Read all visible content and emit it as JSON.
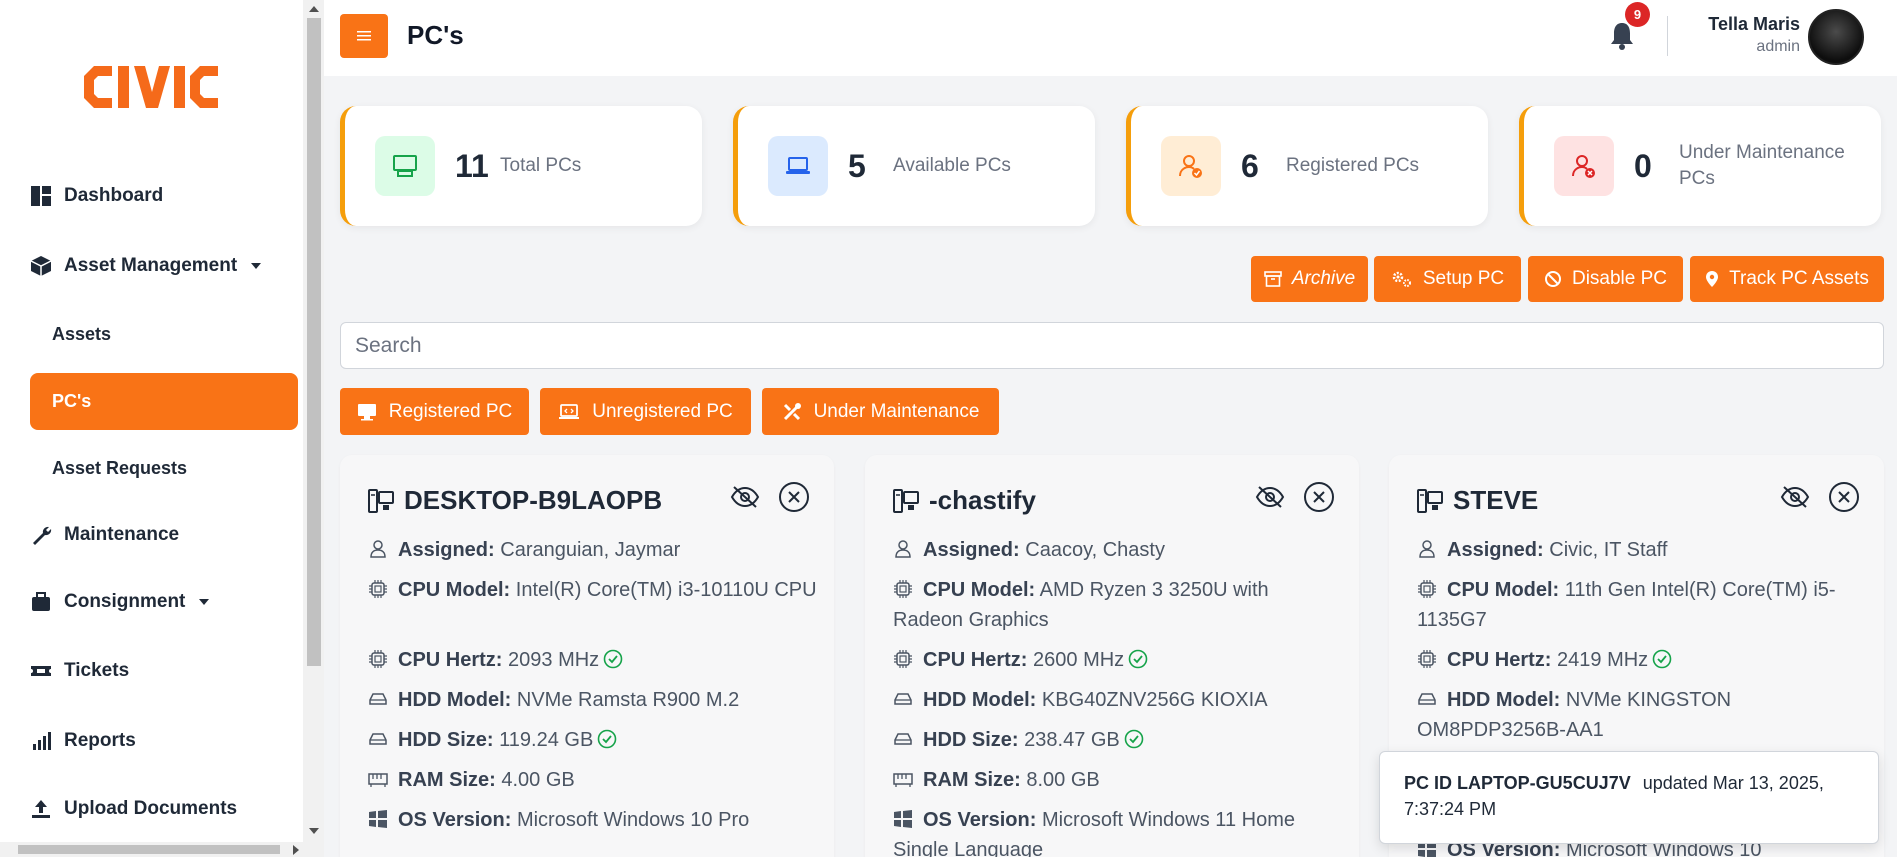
{
  "app": {
    "logo_text": "CIVIC"
  },
  "sidebar": {
    "items": [
      {
        "label": "Dashboard"
      },
      {
        "label": "Asset Management"
      },
      {
        "label": "Assets"
      },
      {
        "label": "PC's"
      },
      {
        "label": "Asset Requests"
      },
      {
        "label": "Maintenance"
      },
      {
        "label": "Consignment"
      },
      {
        "label": "Tickets"
      },
      {
        "label": "Reports"
      },
      {
        "label": "Upload Documents"
      }
    ]
  },
  "header": {
    "title": "PC's",
    "notification_count": "9",
    "user_name": "Tella Maris",
    "user_role": "admin"
  },
  "stats": [
    {
      "value": "11",
      "label": "Total PCs"
    },
    {
      "value": "5",
      "label": "Available PCs"
    },
    {
      "value": "6",
      "label": "Registered PCs"
    },
    {
      "value": "0",
      "label": "Under Maintenance PCs"
    }
  ],
  "actions": {
    "archive": "Archive",
    "setup": "Setup PC",
    "disable": "Disable PC",
    "track": "Track PC Assets"
  },
  "search": {
    "placeholder": "Search"
  },
  "filters": {
    "registered": "Registered PC",
    "unregistered": "Unregistered PC",
    "maintenance": "Under Maintenance"
  },
  "field_labels": {
    "assigned": "Assigned:",
    "cpu_model": "CPU Model:",
    "cpu_hertz": "CPU Hertz:",
    "hdd_model": "HDD Model:",
    "hdd_size": "HDD Size:",
    "ram_size": "RAM Size:",
    "os_version": "OS Version:"
  },
  "pcs": [
    {
      "name": "DESKTOP-B9LAOPB",
      "assigned": "Caranguian, Jaymar",
      "cpu_model": "Intel(R) Core(TM) i3-10110U CPU",
      "cpu_hertz": "2093 MHz",
      "hdd_model": "NVMe Ramsta R900 M.2",
      "hdd_size": "119.24 GB",
      "ram_size": "4.00 GB",
      "os_version": "Microsoft Windows 10 Pro"
    },
    {
      "name": "-chastify",
      "assigned": "Caacoy, Chasty",
      "cpu_model": "AMD Ryzen 3 3250U with Radeon Graphics",
      "cpu_hertz": "2600 MHz",
      "hdd_model": "KBG40ZNV256G KIOXIA",
      "hdd_size": "238.47 GB",
      "ram_size": "8.00 GB",
      "os_version": "Microsoft Windows 11 Home Single Language"
    },
    {
      "name": "STEVE",
      "assigned": "Civic, IT Staff",
      "cpu_model": "11th Gen Intel(R) Core(TM) i5-1135G7",
      "cpu_hertz": "2419 MHz",
      "hdd_model": "NVMe KINGSTON OM8PDP3256B-AA1",
      "os_version": "Microsoft Windows 10"
    }
  ],
  "toast": {
    "pc_id": "PC ID LAPTOP-GU5CUJ7V",
    "message": "updated Mar 13, 2025, 7:37:24 PM"
  },
  "colors": {
    "accent": "#f97316",
    "card_border": "#f59e0b",
    "badge": "#dc2626",
    "check": "#16a34a"
  }
}
